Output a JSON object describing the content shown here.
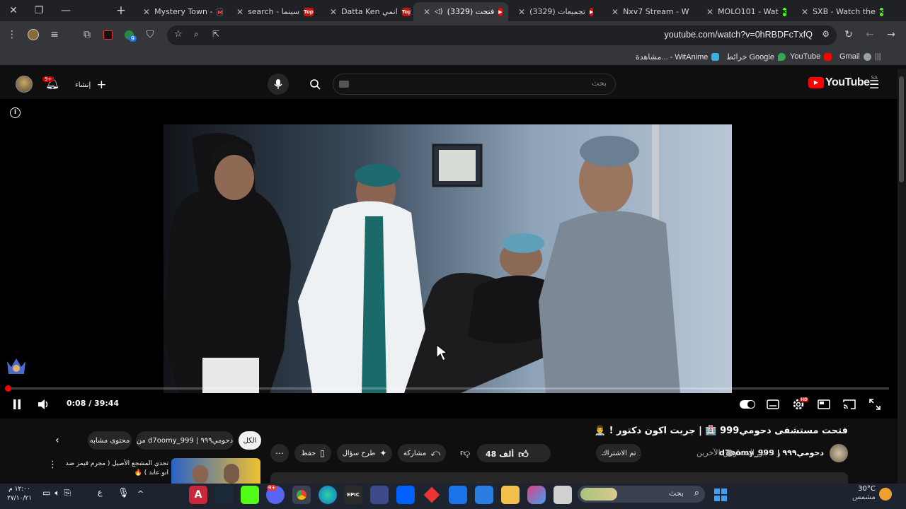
{
  "browser": {
    "tabs": [
      {
        "title": "Mystery Town - ",
        "favicon": "dk"
      },
      {
        "title": "search - سينما",
        "favicon": "top"
      },
      {
        "title": "Datta Ken انمي",
        "favicon": "top"
      },
      {
        "title": "(3329) فتحت",
        "favicon": "yt",
        "active": true
      },
      {
        "title": "(3329) تجميعات",
        "favicon": "yt"
      },
      {
        "title": "Nxv7 Stream - W",
        "favicon": "kick"
      },
      {
        "title": "MOLO101 - Wat",
        "favicon": "kick"
      },
      {
        "title": "SXB - Watch the",
        "favicon": "kick"
      }
    ],
    "url": "youtube.com/watch?v=0hRBDFcTxfQ",
    "extension_badge": "9",
    "bookmarks": [
      {
        "label": "Gmail",
        "color": "#9aa0a6"
      },
      {
        "label": "YouTube",
        "color": "#ff0000"
      },
      {
        "label": "خرائط Google",
        "color": "#34a853"
      },
      {
        "label": "مشاهدة... - WitAnime",
        "color": "#3ab0e0"
      }
    ]
  },
  "youtube": {
    "logo_text": "YouTube",
    "region": "SA",
    "search_placeholder": "بحث",
    "create_label": "إنشاء",
    "notifications_badge": "9+"
  },
  "player": {
    "time_display": "0:08 / 39:44",
    "progress": 0.0034,
    "quality_badge": "HD"
  },
  "video": {
    "title": "فتحت مستشفى دحومي999 🏥 | جربت اكون دكتور ! 👨‍⚕️",
    "channel": "d7oomy_999 | دحومي٩٩٩",
    "collaborators": "و 3 من المتعاونين الآخرين",
    "subscribe_label": "تم الاشتراك",
    "likes": "48 ألف",
    "share_label": "مشاركة",
    "ask_label": "طرح سؤال",
    "save_label": "حفظ"
  },
  "recommendations": {
    "chips": [
      "الكل",
      "من d7oomy_999 | دحومي٩٩٩",
      "محتوى مشابه"
    ],
    "first_title": "تحدي المشجع الأصيل ( مجرم قيمز ضد ابو عابد ) 🔥"
  },
  "taskbar": {
    "search_placeholder": "بحث",
    "temperature": "30°C",
    "weather": "مشمس",
    "clock_time": "١٢:٠٠ م",
    "clock_date": "٢٧/١٠/٢١",
    "lang": "ع",
    "discord_badge": "9+"
  }
}
